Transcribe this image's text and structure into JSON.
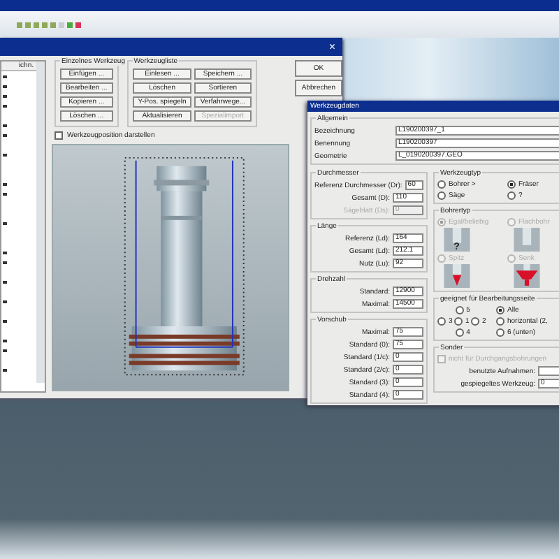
{
  "tool_list_dialog": {
    "list_header": "ichn.",
    "single_tool": {
      "title": "Einzelnes Werkzeug",
      "buttons": [
        {
          "label": "Einfügen ...",
          "disabled": false
        },
        {
          "label": "Bearbeiten ...",
          "disabled": false
        },
        {
          "label": "Kopieren ...",
          "disabled": false
        },
        {
          "label": "Löschen ...",
          "disabled": false
        }
      ]
    },
    "tool_list": {
      "title": "Werkzeugliste",
      "buttons": [
        {
          "label": "Einlesen ...",
          "disabled": false
        },
        {
          "label": "Speichern ...",
          "disabled": false
        },
        {
          "label": "Löschen",
          "disabled": false
        },
        {
          "label": "Sortieren",
          "disabled": false
        },
        {
          "label": "Y-Pos. spiegeln",
          "disabled": false
        },
        {
          "label": "Verfahrwege...",
          "disabled": false
        },
        {
          "label": "Aktualisieren",
          "disabled": false
        },
        {
          "label": "Spezialimport",
          "disabled": true
        }
      ]
    },
    "close": "×",
    "ok": "OK",
    "cancel": "Abbrechen",
    "show_position": {
      "label": "Werkzeugposition darstellen",
      "checked": false
    }
  },
  "tool_data_dialog": {
    "title": "Werkzeugdaten",
    "general": {
      "title": "Allgemein",
      "fields": [
        {
          "label": "Bezeichnung",
          "value": "L190200397_1"
        },
        {
          "label": "Benennung",
          "value": "L190200397"
        },
        {
          "label": "Geometrie",
          "value": "L_0190200397.GEO"
        }
      ]
    },
    "diameter": {
      "title": "Durchmesser",
      "fields": [
        {
          "label": "Referenz Durchmesser (Dr):",
          "value": "60",
          "disabled": false
        },
        {
          "label": "Gesamt (D):",
          "value": "110",
          "disabled": false
        },
        {
          "label": "Sägeblatt (Ds):",
          "value": "0",
          "disabled": true
        }
      ]
    },
    "length": {
      "title": "Länge",
      "fields": [
        {
          "label": "Referenz (Ld):",
          "value": "164",
          "disabled": false
        },
        {
          "label": "Gesamt (Ld):",
          "value": "212.1",
          "disabled": false
        },
        {
          "label": "Nutz (Lu):",
          "value": "92",
          "disabled": false
        }
      ]
    },
    "speed": {
      "title": "Drehzahl",
      "fields": [
        {
          "label": "Standard:",
          "value": "12900",
          "disabled": false
        },
        {
          "label": "Maximal:",
          "value": "14500",
          "disabled": false
        }
      ]
    },
    "feed": {
      "title": "Vorschub",
      "fields": [
        {
          "label": "Maximal:",
          "value": "75",
          "disabled": false
        },
        {
          "label": "Standard (0):",
          "value": "75",
          "disabled": false
        },
        {
          "label": "Standard (1/c):",
          "value": "0",
          "disabled": false
        },
        {
          "label": "Standard (2/c):",
          "value": "0",
          "disabled": false
        },
        {
          "label": "Standard (3):",
          "value": "0",
          "disabled": false
        },
        {
          "label": "Standard (4):",
          "value": "0",
          "disabled": false
        }
      ]
    },
    "tool_type": {
      "title": "Werkzeugtyp",
      "options": [
        {
          "label": "Bohrer >",
          "selected": false
        },
        {
          "label": "Fräser",
          "selected": true
        },
        {
          "label": "Säge",
          "selected": false
        },
        {
          "label": "?",
          "selected": false
        }
      ]
    },
    "drill_type": {
      "title": "Bohrertyp",
      "options": [
        {
          "label": "Egal/beliebig",
          "selected": true,
          "disabled": true,
          "kind": "unknown",
          "tile_text": "?"
        },
        {
          "label": "Flachbohr",
          "selected": false,
          "disabled": true,
          "kind": "flat"
        },
        {
          "label": "Spitz",
          "selected": false,
          "disabled": true,
          "kind": "pointed"
        },
        {
          "label": "Senk",
          "selected": false,
          "disabled": true,
          "kind": "countersink"
        }
      ]
    },
    "sides": {
      "title": "geeignet für Bearbeitungsseite",
      "top": {
        "label": "5",
        "selected": false
      },
      "middle": [
        {
          "label": "3",
          "selected": false
        },
        {
          "label": "1",
          "selected": false
        },
        {
          "label": "2",
          "selected": false
        }
      ],
      "bottom": {
        "label": "4",
        "selected": false
      },
      "other": [
        {
          "label": "Alle",
          "selected": true
        },
        {
          "label": "horizontal (2,",
          "selected": false
        },
        {
          "label": "6 (unten)",
          "selected": false
        }
      ]
    },
    "special": {
      "title": "Sonder",
      "through_holes": {
        "label": "nicht für Durchgangsbohrungen",
        "checked": false,
        "disabled": true
      },
      "fields": [
        {
          "label": "benutzte Aufnahmen:"
        },
        {
          "label": "gespiegeltes Werkzeug:",
          "value": "0"
        }
      ]
    }
  }
}
